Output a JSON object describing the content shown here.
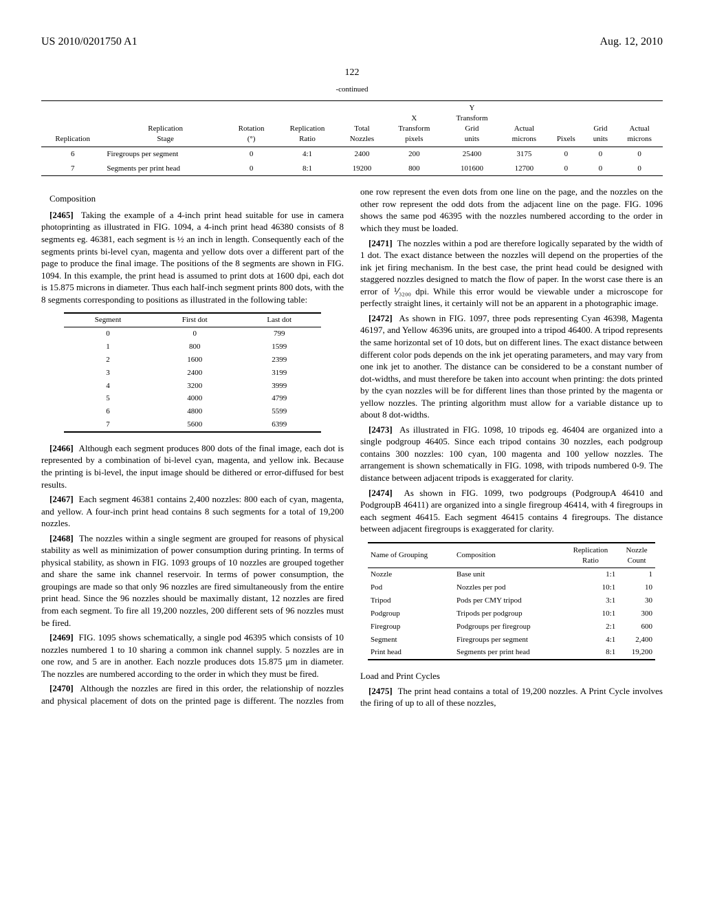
{
  "header": {
    "pub_number": "US 2010/0201750 A1",
    "date": "Aug. 12, 2010",
    "page": "122"
  },
  "top_table": {
    "caption": "-continued",
    "headers": [
      "Replication",
      "Replication Stage",
      "Rotation (°)",
      "Replication Ratio",
      "Total Nozzles",
      "X Transform pixels",
      "Y Transform Grid units",
      "Actual microns",
      "Pixels",
      "Grid units",
      "Actual microns"
    ],
    "rows": [
      [
        "6",
        "Firegroups per segment",
        "0",
        "4:1",
        "2400",
        "200",
        "25400",
        "3175",
        "0",
        "0",
        "0"
      ],
      [
        "7",
        "Segments per print head",
        "0",
        "8:1",
        "19200",
        "800",
        "101600",
        "12700",
        "0",
        "0",
        "0"
      ]
    ]
  },
  "segment_table": {
    "headers": [
      "Segment",
      "First dot",
      "Last dot"
    ],
    "rows": [
      [
        "0",
        "0",
        "799"
      ],
      [
        "1",
        "800",
        "1599"
      ],
      [
        "2",
        "1600",
        "2399"
      ],
      [
        "3",
        "2400",
        "3199"
      ],
      [
        "4",
        "3200",
        "3999"
      ],
      [
        "5",
        "4000",
        "4799"
      ],
      [
        "6",
        "4800",
        "5599"
      ],
      [
        "7",
        "5600",
        "6399"
      ]
    ]
  },
  "grouping_table": {
    "headers": [
      "Name of Grouping",
      "Composition",
      "Replication Ratio",
      "Nozzle Count"
    ],
    "rows": [
      [
        "Nozzle",
        "Base unit",
        "1:1",
        "1"
      ],
      [
        "Pod",
        "Nozzles per pod",
        "10:1",
        "10"
      ],
      [
        "Tripod",
        "Pods per CMY tripod",
        "3:1",
        "30"
      ],
      [
        "Podgroup",
        "Tripods per podgroup",
        "10:1",
        "300"
      ],
      [
        "Firegroup",
        "Podgroups per firegroup",
        "2:1",
        "600"
      ],
      [
        "Segment",
        "Firegroups per segment",
        "4:1",
        "2,400"
      ],
      [
        "Print head",
        "Segments per print head",
        "8:1",
        "19,200"
      ]
    ]
  },
  "text": {
    "heading1": "Composition",
    "p2465": "Taking the example of a 4-inch print head suitable for use in camera photoprinting as illustrated in FIG. 1094, a 4-inch print head 46380 consists of 8 segments eg. 46381, each segment is ½ an inch in length. Consequently each of the segments prints bi-level cyan, magenta and yellow dots over a different part of the page to produce the final image. The positions of the 8 segments are shown in FIG. 1094. In this example, the print head is assumed to print dots at 1600 dpi, each dot is 15.875 microns in diameter. Thus each half-inch segment prints 800 dots, with the 8 segments corresponding to positions as illustrated in the following table:",
    "p2466": "Although each segment produces 800 dots of the final image, each dot is represented by a combination of bi-level cyan, magenta, and yellow ink. Because the printing is bi-level, the input image should be dithered or error-diffused for best results.",
    "p2467": "Each segment 46381 contains 2,400 nozzles: 800 each of cyan, magenta, and yellow. A four-inch print head contains 8 such segments for a total of 19,200 nozzles.",
    "p2468": "The nozzles within a single segment are grouped for reasons of physical stability as well as minimization of power consumption during printing. In terms of physical stability, as shown in FIG. 1093 groups of 10 nozzles are grouped together and share the same ink channel reservoir. In terms of power consumption, the groupings are made so that only 96 nozzles are fired simultaneously from the entire print head. Since the 96 nozzles should be maximally distant, 12 nozzles are fired from each segment. To fire all 19,200 nozzles, 200 different sets of 96 nozzles must be fired.",
    "p2469": "FIG. 1095 shows schematically, a single pod 46395 which consists of 10 nozzles numbered 1 to 10 sharing a common ink channel supply. 5 nozzles are in one row, and 5 are in another. Each nozzle produces dots 15.875 μm in diameter. The nozzles are numbered according to the order in which they must be fired.",
    "p2470": "Although the nozzles are fired in this order, the relationship of nozzles and physical placement of dots on the printed page is different. The nozzles from one row represent the even dots from one line on the page, and the nozzles on the other row represent the odd dots from the adjacent line on the page. FIG. 1096 shows the same pod 46395 with the nozzles numbered according to the order in which they must be loaded.",
    "p2471": "The nozzles within a pod are therefore logically separated by the width of 1 dot. The exact distance between the nozzles will depend on the properties of the ink jet firing mechanism. In the best case, the print head could be designed with staggered nozzles designed to match the flow of paper. In the worst case there is an error of ⅟₃₂₀₀ dpi. While this error would be viewable under a microscope for perfectly straight lines, it certainly will not be an apparent in a photographic image.",
    "p2472": "As shown in FIG. 1097, three pods representing Cyan 46398, Magenta 46197, and Yellow 46396 units, are grouped into a tripod 46400. A tripod represents the same horizontal set of 10 dots, but on different lines. The exact distance between different color pods depends on the ink jet operating parameters, and may vary from one ink jet to another. The distance can be considered to be a constant number of dot-widths, and must therefore be taken into account when printing: the dots printed by the cyan nozzles will be for different lines than those printed by the magenta or yellow nozzles. The printing algorithm must allow for a variable distance up to about 8 dot-widths.",
    "p2473": "As illustrated in FIG. 1098, 10 tripods eg. 46404 are organized into a single podgroup 46405. Since each tripod contains 30 nozzles, each podgroup contains 300 nozzles: 100 cyan, 100 magenta and 100 yellow nozzles. The arrangement is shown schematically in FIG. 1098, with tripods numbered 0-9. The distance between adjacent tripods is exaggerated for clarity.",
    "p2474": "As shown in FIG. 1099, two podgroups (PodgroupA 46410 and PodgroupB 46411) are organized into a single firegroup 46414, with 4 firegroups in each segment 46415. Each segment 46415 contains 4 firegroups. The distance between adjacent firegroups is exaggerated for clarity.",
    "heading2": "Load and Print Cycles",
    "p2475": "The print head contains a total of 19,200 nozzles. A Print Cycle involves the firing of up to all of these nozzles,"
  },
  "labels": {
    "l2465": "[2465]",
    "l2466": "[2466]",
    "l2467": "[2467]",
    "l2468": "[2468]",
    "l2469": "[2469]",
    "l2470": "[2470]",
    "l2471": "[2471]",
    "l2472": "[2472]",
    "l2473": "[2473]",
    "l2474": "[2474]",
    "l2475": "[2475]"
  }
}
